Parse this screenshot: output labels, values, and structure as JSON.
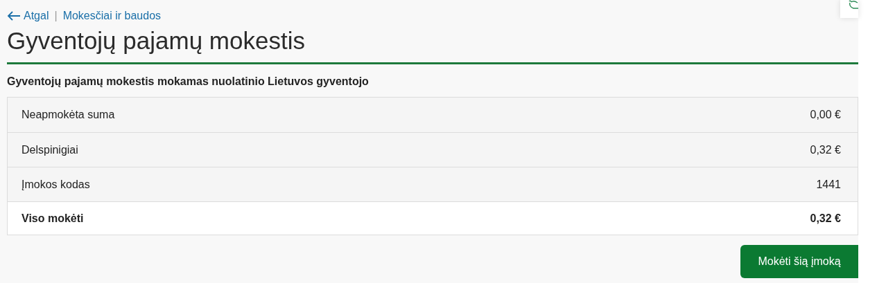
{
  "breadcrumb": {
    "back": "Atgal",
    "separator": "|",
    "link": "Mokesčiai ir baudos"
  },
  "title": "Gyventojų pajamų mokestis",
  "subtitle": "Gyventojų pajamų mokestis mokamas nuolatinio Lietuvos gyventojo",
  "rows": [
    {
      "kind": "item",
      "label": "Neapmokėta suma",
      "value": "0,00 €"
    },
    {
      "kind": "item",
      "label": "Delspinigiai",
      "value": "0,32 €"
    },
    {
      "kind": "item",
      "label": "Įmokos kodas",
      "value": "1441"
    },
    {
      "kind": "total",
      "label": "Viso mokėti",
      "value": "0,32 €"
    }
  ],
  "button": "Mokėti šią įmoką"
}
